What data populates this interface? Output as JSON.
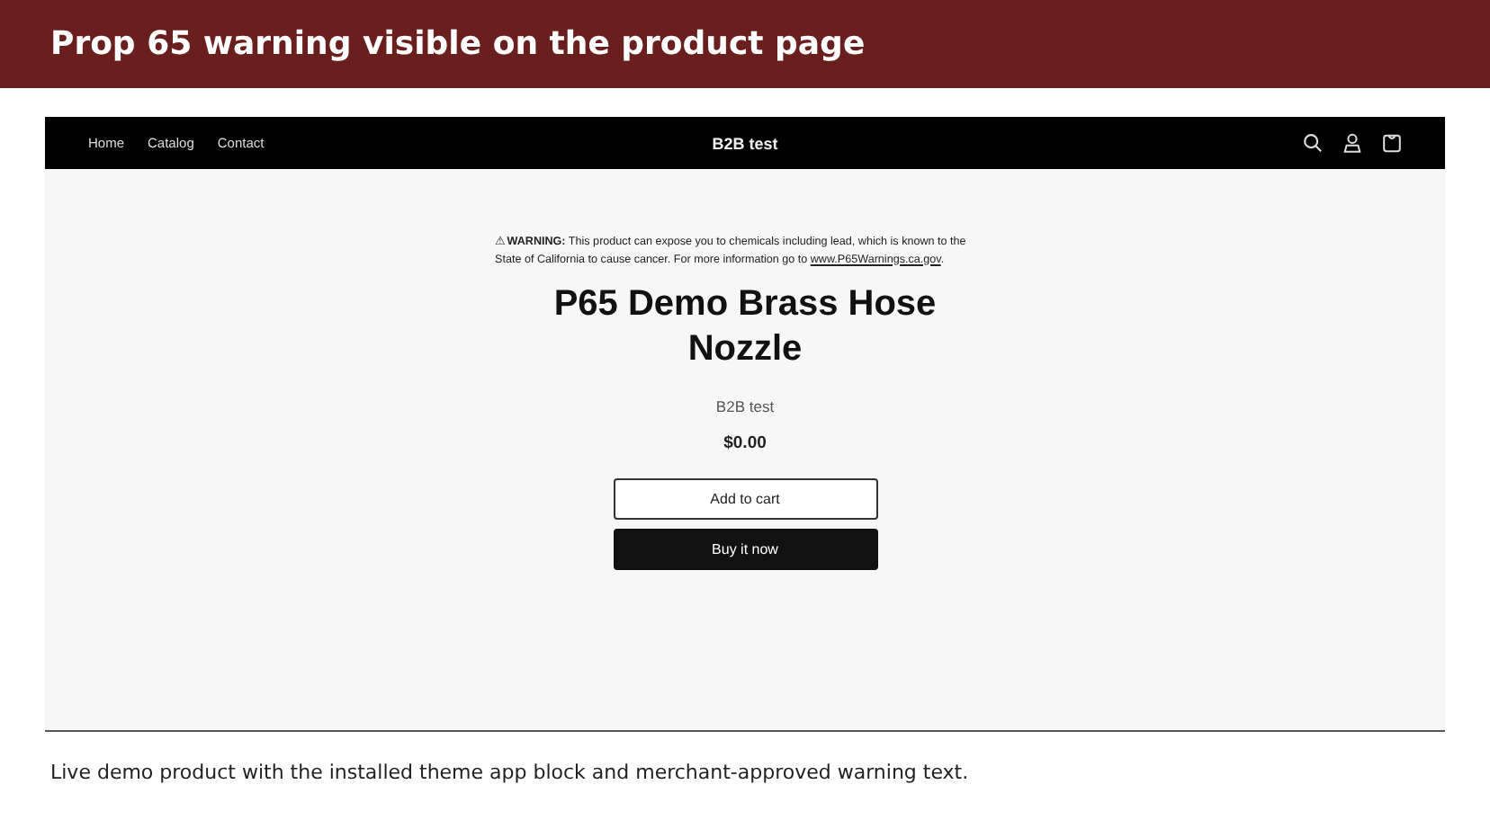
{
  "header": {
    "title": "Prop 65 warning visible on the product page"
  },
  "store": {
    "nav": [
      "Home",
      "Catalog",
      "Contact"
    ],
    "name": "B2B test",
    "warning": {
      "text": "⚠ **WARNING:** This product can expose you to chemicals including lead, which is known to the State of California to cause cancer. For more information go to ",
      "link": "www.P65Warnings.ca.gov",
      "end": "."
    },
    "product_title": "P65 Demo Brass Hose Nozzle",
    "vendor": "B2B test",
    "price": "$0.00",
    "buttons": [
      {
        "label": "Add to cart",
        "kind": "outline"
      },
      {
        "label": "Buy it now",
        "kind": "solid"
      }
    ]
  },
  "caption": "Live demo product with the installed theme app block and merchant-approved warning text."
}
